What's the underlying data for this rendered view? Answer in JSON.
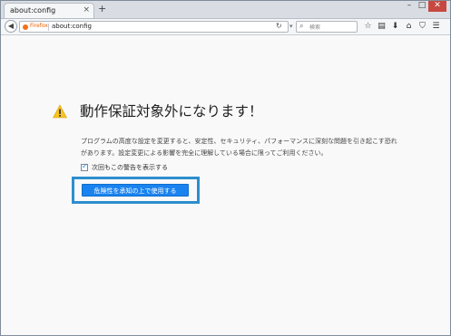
{
  "browser": {
    "tab": {
      "title": "about:config",
      "close_glyph": "×"
    },
    "new_tab_glyph": "+",
    "window_controls": {
      "minimize": "–",
      "maximize": "□",
      "close": "✕"
    },
    "urlbar": {
      "brand": "Firefox",
      "url": "about:config"
    },
    "search": {
      "placeholder": "検索"
    },
    "toolbar_icons": [
      "star-icon",
      "clipboard-icon",
      "download-icon",
      "home-icon",
      "pocket-icon",
      "menu-icon"
    ]
  },
  "page": {
    "title": "動作保証対象外になります！",
    "description": "プログラムの高度な設定を変更すると、安定性、セキュリティ、パフォーマンスに深刻な問題を引き起こす恐れがあります。設定変更による影響を完全に理解している場合に限ってご利用ください。",
    "checkbox": {
      "label": "次回もこの警告を表示する",
      "checked": true
    },
    "accept_button": "危険性を承知の上で使用する"
  },
  "colors": {
    "accent": "#1a83ef",
    "highlight": "#2d8ecd",
    "warning": "#f7c325",
    "window_close": "#c7483f"
  }
}
